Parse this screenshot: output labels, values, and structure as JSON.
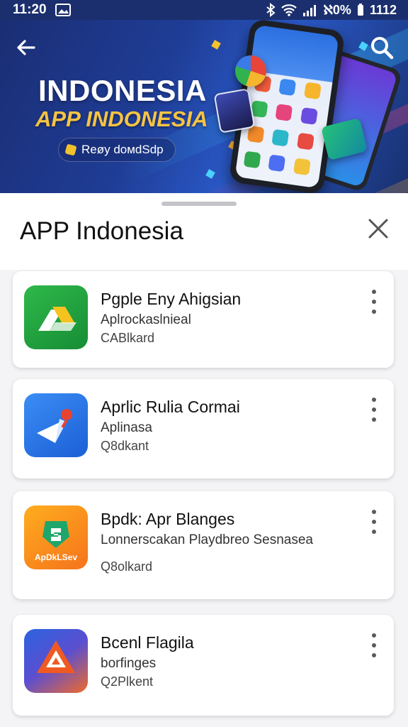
{
  "status_bar": {
    "time": "11:20",
    "battery_text": "ℵ0%",
    "battery_level": "1112"
  },
  "banner": {
    "title": "INDONESIA",
    "subtitle": "APP INDONESIA",
    "pill_label": "Reøy doмdSdp"
  },
  "sheet": {
    "title": "APP Indonesia"
  },
  "apps": [
    {
      "name": "Pgple Eny Ahigsian",
      "subtitle": "Aplrockaslnieal",
      "meta": "CABlkard",
      "icon": "drive-triangle-icon"
    },
    {
      "name": "Aprlic Rulia Cormai",
      "subtitle": "Aplinasa",
      "meta": "Q8dkant",
      "icon": "pin-arrow-icon"
    },
    {
      "name": "Bpdk: Apr Blanges",
      "subtitle": "Lonnerscakan Playdbreo Sesnasea",
      "meta": "Q8olkard",
      "icon": "shield-badge-icon",
      "icon_text": "ApDkLSev"
    },
    {
      "name": "Bcenl Flagila",
      "subtitle": "borfinges",
      "meta": "Q2Plkent",
      "icon": "triangle-alert-icon"
    }
  ],
  "colors": {
    "banner_bg": "#1f3d96",
    "subtitle_gold": "#f6c443",
    "card_bg": "#ffffff"
  }
}
